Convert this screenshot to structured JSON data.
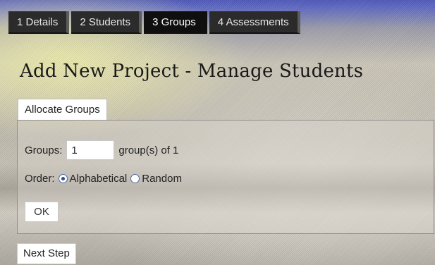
{
  "wizard": {
    "tabs": [
      {
        "label": "1 Details"
      },
      {
        "label": "2 Students"
      },
      {
        "label": "3 Groups"
      },
      {
        "label": "4 Assessments"
      }
    ],
    "active_tab": "3 Groups"
  },
  "page": {
    "title": "Add New Project - Manage Students"
  },
  "allocate": {
    "section_label": "Allocate Groups",
    "groups_label": "Groups:",
    "groups_value": "1",
    "groups_suffix": "group(s) of 1",
    "order_label": "Order:",
    "order_options": [
      {
        "label": "Alphabetical",
        "selected": true
      },
      {
        "label": "Random",
        "selected": false
      }
    ],
    "ok_label": "OK"
  },
  "footer": {
    "next_label": "Next Step"
  },
  "colors": {
    "tab_bg": "#2b2b2b",
    "tab_active_bg": "#0f0f0f",
    "top_bar": "#4c55b5"
  }
}
